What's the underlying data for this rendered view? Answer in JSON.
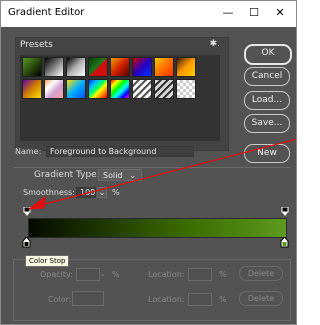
{
  "window": {
    "title": "Gradient Editor",
    "minimize_glyph": "—",
    "maximize_glyph": "☐",
    "close_glyph": "✕"
  },
  "presets": {
    "label": "Presets",
    "gear_glyph": "✱."
  },
  "buttons": {
    "ok": "OK",
    "cancel": "Cancel",
    "load": "Load...",
    "save": "Save...",
    "new": "New"
  },
  "name": {
    "label": "Name:",
    "value": "Foreground to Background"
  },
  "gradient_type": {
    "label": "Gradient Type:",
    "value": "Solid"
  },
  "smoothness": {
    "label": "Smoothness:",
    "value": "100",
    "unit": "%"
  },
  "ramp": {
    "start_color": "#050a00",
    "end_color": "#5d9a1e"
  },
  "tooltip": {
    "text": "Color Stop"
  },
  "stops": {
    "opacity_label": "Opacity:",
    "opacity_unit": "%",
    "location_label": "Location:",
    "location_unit": "%",
    "delete_label": "Delete",
    "color_label": "Color:"
  },
  "annotation": {
    "arrow_color": "#e01010"
  }
}
